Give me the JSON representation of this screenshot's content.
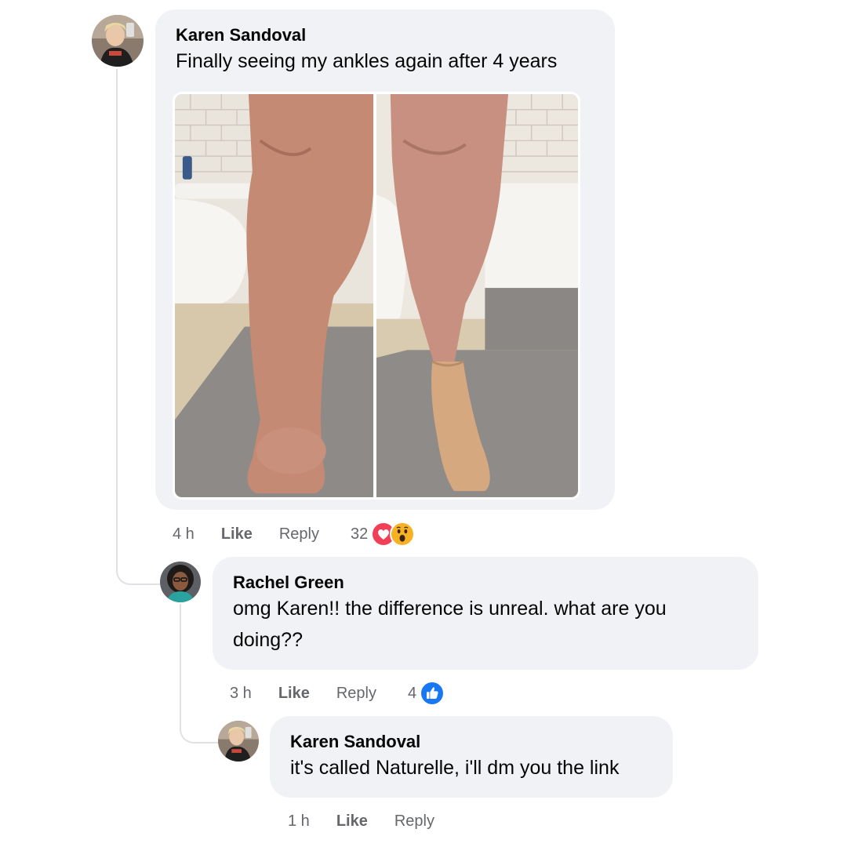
{
  "comments": [
    {
      "author": "Karen Sandoval",
      "text": "Finally seeing my ankles again after 4 years",
      "time": "4 h",
      "like_label": "Like",
      "reply_label": "Reply",
      "reaction_count": "32",
      "reactions": [
        "love-reaction-icon",
        "wow-reaction-icon"
      ]
    },
    {
      "author": "Rachel Green",
      "text": "omg Karen!! the difference is unreal. what are you doing??",
      "time": "3 h",
      "like_label": "Like",
      "reply_label": "Reply",
      "reaction_count": "4",
      "reactions": [
        "like-reaction-icon"
      ]
    },
    {
      "author": "Karen Sandoval",
      "text": "it's called Naturelle, i'll dm you the link",
      "time": "1 h",
      "like_label": "Like",
      "reply_label": "Reply"
    }
  ],
  "colors": {
    "bubble": "#f0f2f5",
    "meta_text": "#65676b",
    "like_blue": "#1877f2",
    "love_red": "#f33e58",
    "wow_yellow": "#f7b125"
  }
}
